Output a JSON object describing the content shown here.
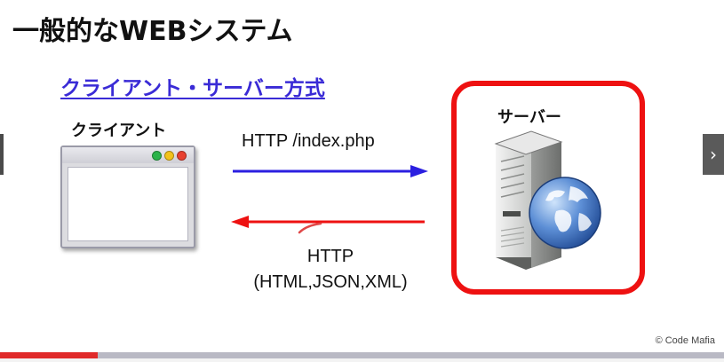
{
  "slide": {
    "title": "一般的なWEBシステム",
    "subtitle": "クライアント・サーバー方式"
  },
  "client": {
    "label": "クライアント",
    "window_dot_colors": [
      "#2bb34a",
      "#f2c21b",
      "#e8402f"
    ]
  },
  "request": {
    "label": "HTTP /index.php",
    "color": "#2b1fe0"
  },
  "response": {
    "line1": "HTTP",
    "line2": "(HTML,JSON,XML)",
    "color": "#ee1111"
  },
  "server": {
    "label": "サーバー",
    "icon": "server-with-globe-icon",
    "highlight_color": "#ee1111"
  },
  "navigation": {
    "next_glyph": "›"
  },
  "footer": {
    "copyright": "© Code Mafia"
  },
  "player": {
    "progress_fraction": 0.135,
    "progress_color": "#e02a2a"
  }
}
